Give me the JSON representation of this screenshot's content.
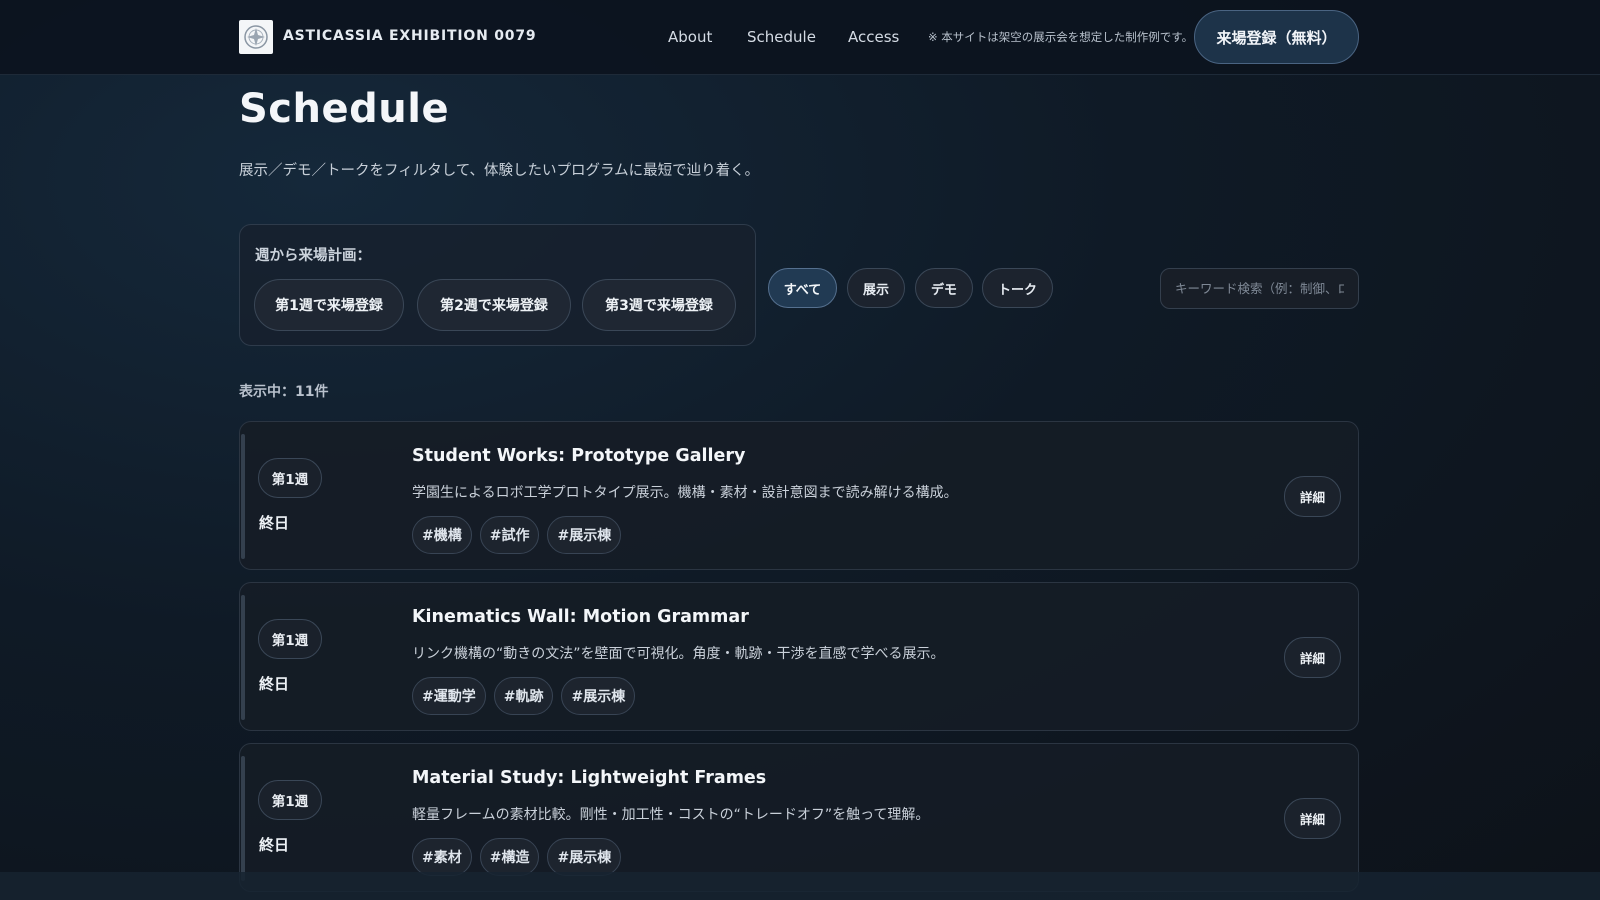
{
  "header": {
    "brand": "ASTICASSIA EXHIBITION 0079",
    "nav": [
      "About",
      "Schedule",
      "Access"
    ],
    "note": "※ 本サイトは架空の展示会を想定した制作例です。",
    "cta": "来場登録（無料）"
  },
  "page": {
    "title": "Schedule",
    "subtitle": "展示／デモ／トークをフィルタして、体験したいプログラムに最短で辿り着く。"
  },
  "week_plan": {
    "label": "週から来場計画：",
    "buttons": [
      "第1週で来場登録",
      "第2週で来場登録",
      "第3週で来場登録"
    ]
  },
  "filters": {
    "chips": [
      "すべて",
      "展示",
      "デモ",
      "トーク"
    ],
    "active": "すべて",
    "search_placeholder": "キーワード検索（例：制御、ロボット）",
    "search_value": ""
  },
  "count_label": "表示中：11件",
  "detail_label": "詳細",
  "items": [
    {
      "week": "第1週",
      "time": "終日",
      "title": "Student Works: Prototype Gallery",
      "desc": "学園生によるロボ工学プロトタイプ展示。機構・素材・設計意図まで読み解ける構成。",
      "tags": [
        "#機構",
        "#試作",
        "#展示棟"
      ]
    },
    {
      "week": "第1週",
      "time": "終日",
      "title": "Kinematics Wall: Motion Grammar",
      "desc": "リンク機構の“動きの文法”を壁面で可視化。角度・軌跡・干渉を直感で学べる展示。",
      "tags": [
        "#運動学",
        "#軌跡",
        "#展示棟"
      ]
    },
    {
      "week": "第1週",
      "time": "終日",
      "title": "Material Study: Lightweight Frames",
      "desc": "軽量フレームの素材比較。剛性・加工性・コストの“トレードオフ”を触って理解。",
      "tags": [
        "#素材",
        "#構造",
        "#展示棟"
      ]
    }
  ]
}
